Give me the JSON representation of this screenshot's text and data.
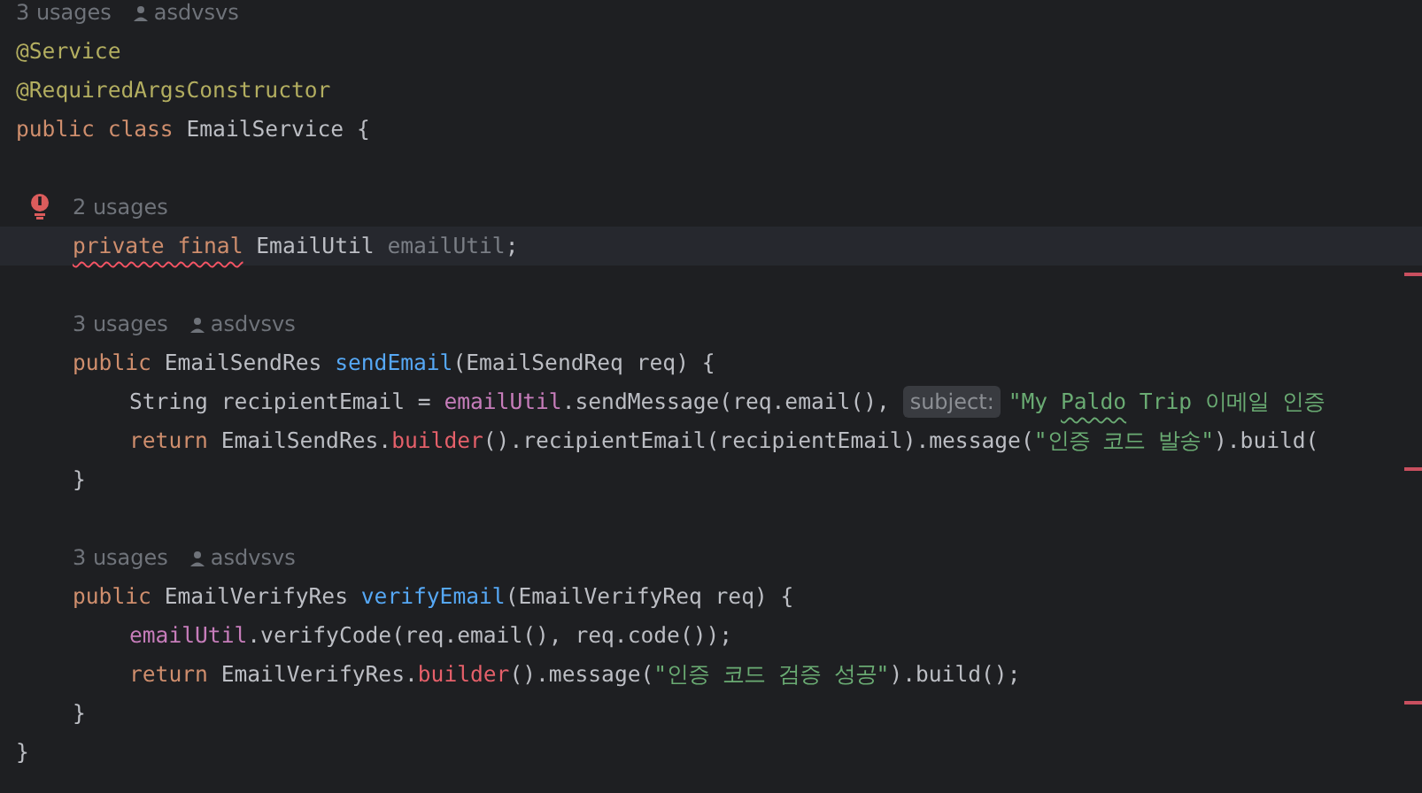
{
  "editor": {
    "lines": [
      {
        "kind": "hint",
        "usages": "3 usages",
        "author": "asdvsvs"
      },
      {
        "kind": "code",
        "tokens": [
          {
            "kind": "annotation",
            "text": "@Service"
          }
        ]
      },
      {
        "kind": "code",
        "tokens": [
          {
            "kind": "annotation",
            "text": "@RequiredArgsConstructor"
          }
        ]
      },
      {
        "kind": "code",
        "tokens": [
          {
            "kind": "keyword",
            "text": "public class"
          },
          {
            "kind": "plain",
            "text": " EmailService {"
          }
        ],
        "children": [
          {
            "kind": "blank"
          },
          {
            "kind": "hint",
            "usages": "2 usages",
            "error_icon": true
          },
          {
            "kind": "code",
            "current": true,
            "tokens": [
              {
                "kind": "keyword",
                "text": "private final",
                "error": true
              },
              {
                "kind": "plain",
                "text": " EmailUtil "
              },
              {
                "kind": "unused",
                "text": "emailUtil"
              },
              {
                "kind": "plain",
                "text": ";"
              }
            ]
          },
          {
            "kind": "blank",
            "stripe": true
          },
          {
            "kind": "hint",
            "usages": "3 usages",
            "author": "asdvsvs"
          },
          {
            "kind": "code",
            "tokens": [
              {
                "kind": "keyword",
                "text": "public"
              },
              {
                "kind": "plain",
                "text": " EmailSendRes "
              },
              {
                "kind": "method",
                "text": "sendEmail"
              },
              {
                "kind": "plain",
                "text": "(EmailSendReq req) {"
              }
            ],
            "children": [
              {
                "kind": "code",
                "tokens": [
                  {
                    "kind": "plain",
                    "text": "String recipientEmail = "
                  },
                  {
                    "kind": "field",
                    "text": "emailUtil"
                  },
                  {
                    "kind": "plain",
                    "text": ".sendMessage(req.email(), "
                  },
                  {
                    "kind": "inlay",
                    "text": "subject:"
                  },
                  {
                    "kind": "string",
                    "text": "\"My "
                  },
                  {
                    "kind": "string",
                    "text": "Paldo",
                    "typo": true
                  },
                  {
                    "kind": "string",
                    "text": " Trip 이메일 인증"
                  }
                ]
              },
              {
                "kind": "code",
                "tokens": [
                  {
                    "kind": "keyword",
                    "text": "return"
                  },
                  {
                    "kind": "plain",
                    "text": " EmailSendRes."
                  },
                  {
                    "kind": "static_call",
                    "text": "builder"
                  },
                  {
                    "kind": "plain",
                    "text": "().recipientEmail(recipientEmail).message("
                  },
                  {
                    "kind": "string",
                    "text": "\"인증 코드 발송\""
                  },
                  {
                    "kind": "plain",
                    "text": ").build("
                  }
                ]
              }
            ]
          },
          {
            "kind": "code",
            "stripe": true,
            "tokens": [
              {
                "kind": "plain",
                "text": "}"
              }
            ]
          },
          {
            "kind": "blank"
          },
          {
            "kind": "hint",
            "usages": "3 usages",
            "author": "asdvsvs"
          },
          {
            "kind": "code",
            "tokens": [
              {
                "kind": "keyword",
                "text": "public"
              },
              {
                "kind": "plain",
                "text": " EmailVerifyRes "
              },
              {
                "kind": "method",
                "text": "verifyEmail"
              },
              {
                "kind": "plain",
                "text": "(EmailVerifyReq req) {"
              }
            ],
            "children": [
              {
                "kind": "code",
                "tokens": [
                  {
                    "kind": "field",
                    "text": "emailUtil"
                  },
                  {
                    "kind": "plain",
                    "text": ".verifyCode(req.email(), req.code());"
                  }
                ]
              },
              {
                "kind": "code",
                "tokens": [
                  {
                    "kind": "keyword",
                    "text": "return"
                  },
                  {
                    "kind": "plain",
                    "text": " EmailVerifyRes."
                  },
                  {
                    "kind": "static_call",
                    "text": "builder"
                  },
                  {
                    "kind": "plain",
                    "text": "().message("
                  },
                  {
                    "kind": "string",
                    "text": "\"인증 코드 검증 성공\""
                  },
                  {
                    "kind": "plain",
                    "text": ").build();"
                  }
                ]
              }
            ]
          },
          {
            "kind": "code",
            "stripe": true,
            "tokens": [
              {
                "kind": "plain",
                "text": "}"
              }
            ]
          }
        ]
      },
      {
        "kind": "code",
        "tokens": [
          {
            "kind": "plain",
            "text": "}"
          }
        ]
      }
    ]
  }
}
